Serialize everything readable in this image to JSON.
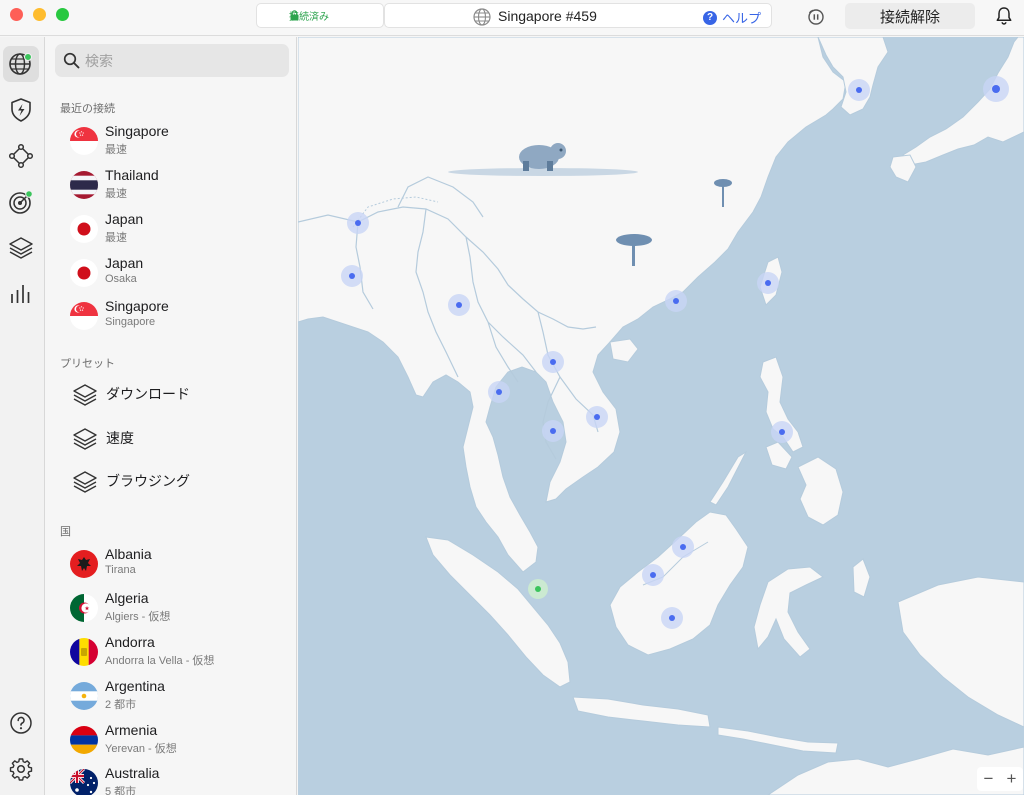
{
  "titlebar": {
    "status": "接続済み",
    "server": "Singapore #459",
    "help": "ヘルプ",
    "help_glyph": "?",
    "disconnect": "接続解除"
  },
  "search": {
    "placeholder": "検索"
  },
  "sections": {
    "recent": "最近の接続",
    "presets": "プリセット",
    "countries": "国"
  },
  "recent": [
    {
      "title": "Singapore",
      "sub": "最速",
      "flag": "singapore"
    },
    {
      "title": "Thailand",
      "sub": "最速",
      "flag": "thailand"
    },
    {
      "title": "Japan",
      "sub": "最速",
      "flag": "japan"
    },
    {
      "title": "Japan",
      "sub": "Osaka",
      "flag": "japan"
    },
    {
      "title": "Singapore",
      "sub": "Singapore",
      "flag": "singapore"
    }
  ],
  "presets": [
    {
      "label": "ダウンロード"
    },
    {
      "label": "速度"
    },
    {
      "label": "ブラウジング"
    }
  ],
  "countries": [
    {
      "title": "Albania",
      "sub": "Tirana",
      "flag": "albania"
    },
    {
      "title": "Algeria",
      "sub": "Algiers - 仮想",
      "flag": "algeria"
    },
    {
      "title": "Andorra",
      "sub": "Andorra la Vella - 仮想",
      "flag": "andorra"
    },
    {
      "title": "Argentina",
      "sub": "2 都市",
      "flag": "argentina"
    },
    {
      "title": "Armenia",
      "sub": "Yerevan - 仮想",
      "flag": "armenia"
    },
    {
      "title": "Australia",
      "sub": "5 都市",
      "flag": "australia"
    }
  ],
  "map": {
    "zoom_out": "−",
    "zoom_in": "+"
  },
  "colors": {
    "accent": "#3865e6",
    "connected": "#2da44e",
    "water": "#b9cfe0",
    "land": "#f7f7f7",
    "border": "#b5cbdc",
    "server_dot": "#4a6cf0"
  }
}
